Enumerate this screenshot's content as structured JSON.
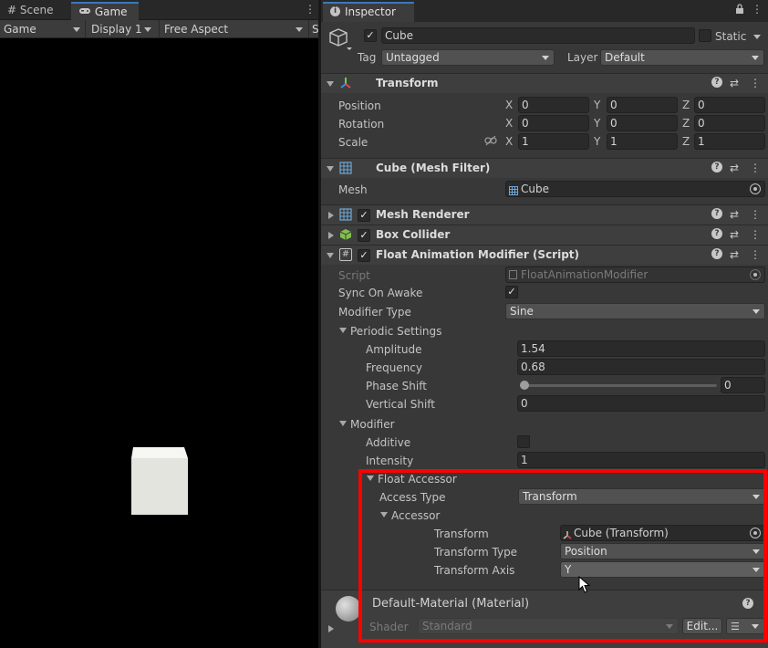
{
  "left_panel": {
    "tabs": [
      {
        "icon": "grid-icon",
        "label": "Scene"
      },
      {
        "icon": "gamepad-icon",
        "label": "Game"
      }
    ],
    "toolbar": {
      "mode": "Game",
      "display": "Display 1",
      "aspect": "Free Aspect",
      "cut": "S"
    }
  },
  "inspector": {
    "tab_label": "Inspector",
    "object": {
      "enabled": true,
      "name": "Cube",
      "static_label": "Static",
      "tag_label": "Tag",
      "tag_value": "Untagged",
      "layer_label": "Layer",
      "layer_value": "Default"
    },
    "transform": {
      "title": "Transform",
      "rows": [
        {
          "label": "Position",
          "x": "0",
          "y": "0",
          "z": "0"
        },
        {
          "label": "Rotation",
          "x": "0",
          "y": "0",
          "z": "0"
        },
        {
          "label": "Scale",
          "x": "1",
          "y": "1",
          "z": "1"
        }
      ],
      "axes": [
        "X",
        "Y",
        "Z"
      ]
    },
    "mesh_filter": {
      "title": "Cube (Mesh Filter)",
      "mesh_label": "Mesh",
      "mesh_value": "Cube"
    },
    "mesh_renderer": {
      "title": "Mesh Renderer",
      "enabled": true
    },
    "box_collider": {
      "title": "Box Collider",
      "enabled": true
    },
    "float_modifier": {
      "title": "Float Animation Modifier (Script)",
      "enabled": true,
      "script_label": "Script",
      "script_value": "FloatAnimationModifier",
      "sync_on_awake_label": "Sync On Awake",
      "sync_on_awake": true,
      "modifier_type_label": "Modifier Type",
      "modifier_type_value": "Sine",
      "periodic_settings_label": "Periodic Settings",
      "amplitude_label": "Amplitude",
      "amplitude": "1.54",
      "frequency_label": "Frequency",
      "frequency": "0.68",
      "phase_shift_label": "Phase Shift",
      "phase_shift": "0",
      "phase_shift_fraction": 0,
      "vertical_shift_label": "Vertical Shift",
      "vertical_shift": "0",
      "modifier_label": "Modifier",
      "additive_label": "Additive",
      "additive": false,
      "intensity_label": "Intensity",
      "intensity": "1",
      "float_accessor_label": "Float Accessor",
      "access_type_label": "Access Type",
      "access_type_value": "Transform",
      "accessor_label": "Accessor",
      "transform_label": "Transform",
      "transform_value": "Cube (Transform)",
      "transform_type_label": "Transform Type",
      "transform_type_value": "Position",
      "transform_axis_label": "Transform Axis",
      "transform_axis_value": "Y"
    },
    "material": {
      "title": "Default-Material (Material)",
      "shader_label": "Shader",
      "shader_value": "Standard",
      "edit_label": "Edit..."
    }
  },
  "colors": {
    "highlight": "#ff0000",
    "tab_accent": "#3a79bb",
    "cube": "#e4e4de"
  }
}
